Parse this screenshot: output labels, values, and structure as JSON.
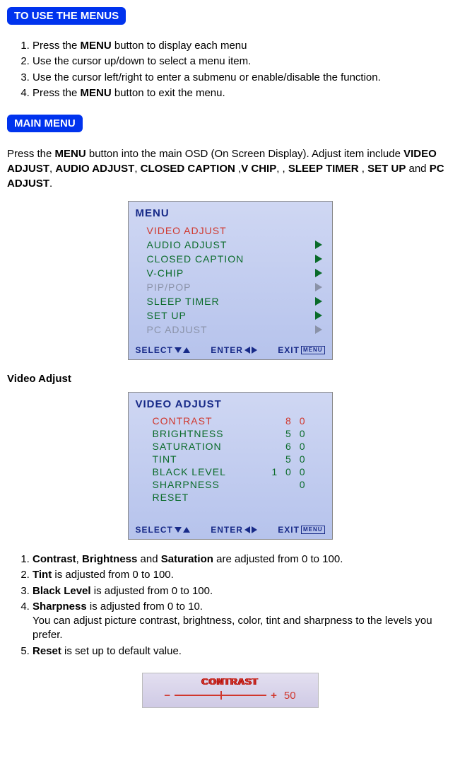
{
  "headers": {
    "use_menus": "TO USE THE MENUS",
    "main_menu": "MAIN MENU"
  },
  "use_steps": {
    "s1a": "Press the ",
    "s1b": "MENU",
    "s1c": " button to display each menu",
    "s2": "Use the cursor up/down to select a menu item.",
    "s3": "Use the cursor left/right to enter a submenu or enable/disable the function.",
    "s4a": "Press the ",
    "s4b": "MENU",
    "s4c": " button to exit the menu."
  },
  "main_para": {
    "p1a": "Press the ",
    "p1b": "MENU",
    "p1c": " button into the main OSD (On Screen Display). Adjust item include ",
    "p2": "VIDEO ADJUST",
    "c1": ", ",
    "p3": "AUDIO ADJUST",
    "c2": ", ",
    "p4": "CLOSED CAPTION",
    "c3": " ,",
    "p5": "V  CHIP",
    "c4": ", , ",
    "p6": "SLEEP TIMER",
    "c5": " , ",
    "p7": "SET UP",
    "c6": " and ",
    "p8": "PC ADJUST",
    "c7": "."
  },
  "osd_menu": {
    "title": "MENU",
    "items": [
      {
        "label": "VIDEO ADJUST",
        "state": "sel",
        "arrow": false
      },
      {
        "label": "AUDIO  ADJUST",
        "state": "on",
        "arrow": true
      },
      {
        "label": "CLOSED CAPTION",
        "state": "on",
        "arrow": true
      },
      {
        "label": "V-CHIP",
        "state": "on",
        "arrow": true
      },
      {
        "label": "PIP/POP",
        "state": "dim",
        "arrow": true
      },
      {
        "label": "SLEEP  TIMER",
        "state": "on",
        "arrow": true
      },
      {
        "label": "SET  UP",
        "state": "on",
        "arrow": true
      },
      {
        "label": "PC  ADJUST",
        "state": "dim",
        "arrow": true
      }
    ],
    "footer": {
      "select": "SELECT",
      "enter": "ENTER",
      "exit": "EXIT",
      "menu": "MENU"
    }
  },
  "video_adjust_label": "Video Adjust",
  "osd_video": {
    "title": "VIDEO ADJUST",
    "items": [
      {
        "label": "CONTRAST",
        "value": "8 0",
        "state": "sel"
      },
      {
        "label": "BRIGHTNESS",
        "value": "5 0",
        "state": "on"
      },
      {
        "label": "SATURATION",
        "value": "6 0",
        "state": "on"
      },
      {
        "label": "TINT",
        "value": "5 0",
        "state": "on"
      },
      {
        "label": "BLACK  LEVEL",
        "value": "1 0 0",
        "state": "on"
      },
      {
        "label": "SHARPNESS",
        "value": "0",
        "state": "on"
      },
      {
        "label": "RESET",
        "value": "",
        "state": "on"
      }
    ]
  },
  "va_steps": {
    "s1a": "Contrast",
    "s1b": ", ",
    "s1c": "Brightness",
    "s1d": " and ",
    "s1e": "Saturation",
    "s1f": " are adjusted from 0 to 100.",
    "s2a": "Tint",
    "s2b": " is adjusted from 0 to 100.",
    "s3a": "Black Level",
    "s3b": " is adjusted from 0 to 100.",
    "s4a": "Sharpness",
    "s4b": " is adjusted from 0 to 10.",
    "s4c": "You can adjust picture contrast, brightness, color, tint and sharpness to the levels you prefer.",
    "s5a": "Reset",
    "s5b": " is set up to default value."
  },
  "slider": {
    "label": "CONTRAST",
    "minus": "−",
    "plus": "+",
    "value": "50"
  }
}
